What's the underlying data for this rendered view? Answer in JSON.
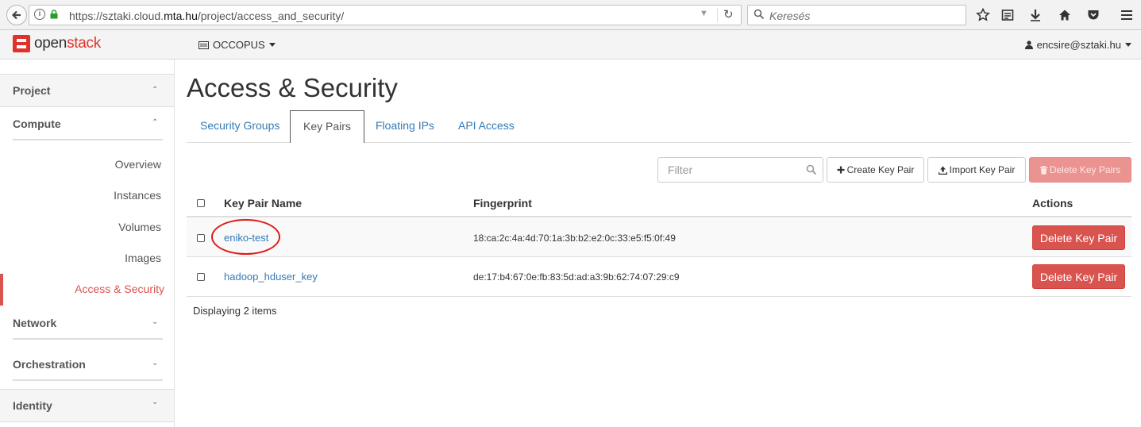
{
  "browser": {
    "url_prefix": "https://sztaki.cloud.",
    "url_domain": "mta.hu",
    "url_suffix": "/project/access_and_security/",
    "search_placeholder": "Keresés"
  },
  "topnav": {
    "logo_open": "open",
    "logo_stack": "stack",
    "project": "OCCOPUS",
    "user": "encsire@sztaki.hu"
  },
  "sidebar": {
    "project": "Project",
    "compute": "Compute",
    "items": [
      "Overview",
      "Instances",
      "Volumes",
      "Images"
    ],
    "active_item": "Access & Security",
    "network": "Network",
    "orchestration": "Orchestration",
    "identity": "Identity"
  },
  "page": {
    "title": "Access & Security",
    "tabs": [
      "Security Groups",
      "Key Pairs",
      "Floating IPs",
      "API Access"
    ],
    "active_tab": "Key Pairs"
  },
  "toolbar": {
    "filter_placeholder": "Filter",
    "create_label": "Create Key Pair",
    "import_label": "Import Key Pair",
    "delete_all_label": "Delete Key Pairs"
  },
  "table": {
    "headers": [
      "Key Pair Name",
      "Fingerprint",
      "Actions"
    ],
    "rows": [
      {
        "name": "eniko-test",
        "fingerprint": "18:ca:2c:4a:4d:70:1a:3b:b2:e2:0c:33:e5:f5:0f:49",
        "action": "Delete Key Pair"
      },
      {
        "name": "hadoop_hduser_key",
        "fingerprint": "de:17:b4:67:0e:fb:83:5d:ad:a3:9b:62:74:07:29:c9",
        "action": "Delete Key Pair"
      }
    ],
    "footer": "Displaying 2 items"
  },
  "colors": {
    "accent": "#d9534f",
    "link": "#337ab7",
    "annotation": "#e01818"
  }
}
